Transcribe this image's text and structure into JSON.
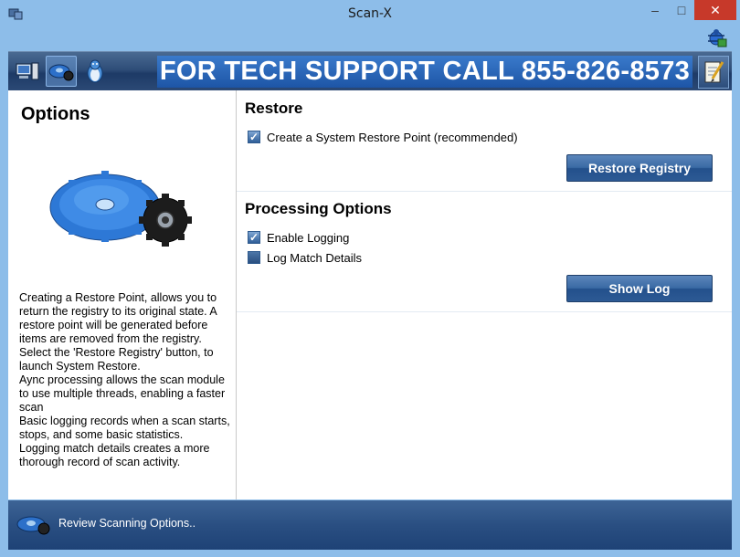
{
  "window": {
    "title": "Scan-X",
    "controls": {
      "minimize": "–",
      "maximize": "□",
      "close": "✕"
    }
  },
  "toolbar": {
    "buttons": [
      {
        "name": "computer-icon",
        "selected": false
      },
      {
        "name": "scan-gear-icon",
        "selected": true
      },
      {
        "name": "penguin-icon",
        "selected": false
      }
    ],
    "banner_text": "FOR TECH SUPPORT CALL 855-826-8573"
  },
  "left_panel": {
    "title": "Options",
    "description_lines": [
      "Creating a Restore Point, allows you to return the registry to its original state. A restore point will be generated before items are removed from the registry. Select the 'Restore Registry' button, to launch System Restore.",
      "Aync processing allows the scan module to use multiple threads, enabling a faster scan",
      "Basic logging records when a scan starts, stops, and some basic statistics.",
      "Logging match details creates a more thorough record of scan activity."
    ]
  },
  "restore": {
    "title": "Restore",
    "create_restore_point": {
      "label": "Create a System Restore Point (recommended)",
      "checked": true
    },
    "restore_button": "Restore Registry"
  },
  "processing": {
    "title": "Processing Options",
    "enable_logging": {
      "label": "Enable Logging",
      "checked": true
    },
    "log_match_details": {
      "label": "Log Match Details",
      "checked": false
    },
    "show_log_button": "Show Log"
  },
  "status_bar": {
    "text": "Review Scanning Options.."
  },
  "colors": {
    "title_bar": "#8dbde9",
    "banner": "#2a66b8",
    "button_blue": "#2d5a94",
    "close_red": "#c7392a"
  }
}
